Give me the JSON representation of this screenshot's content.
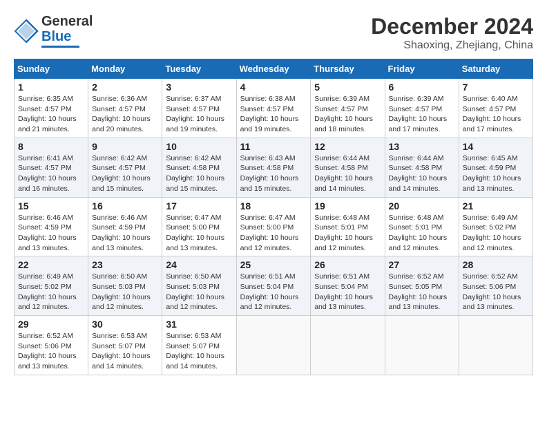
{
  "header": {
    "logo_line1": "General",
    "logo_line2": "Blue",
    "month": "December 2024",
    "location": "Shaoxing, Zhejiang, China"
  },
  "weekdays": [
    "Sunday",
    "Monday",
    "Tuesday",
    "Wednesday",
    "Thursday",
    "Friday",
    "Saturday"
  ],
  "weeks": [
    [
      {
        "day": "1",
        "sunrise": "Sunrise: 6:35 AM",
        "sunset": "Sunset: 4:57 PM",
        "daylight": "Daylight: 10 hours and 21 minutes."
      },
      {
        "day": "2",
        "sunrise": "Sunrise: 6:36 AM",
        "sunset": "Sunset: 4:57 PM",
        "daylight": "Daylight: 10 hours and 20 minutes."
      },
      {
        "day": "3",
        "sunrise": "Sunrise: 6:37 AM",
        "sunset": "Sunset: 4:57 PM",
        "daylight": "Daylight: 10 hours and 19 minutes."
      },
      {
        "day": "4",
        "sunrise": "Sunrise: 6:38 AM",
        "sunset": "Sunset: 4:57 PM",
        "daylight": "Daylight: 10 hours and 19 minutes."
      },
      {
        "day": "5",
        "sunrise": "Sunrise: 6:39 AM",
        "sunset": "Sunset: 4:57 PM",
        "daylight": "Daylight: 10 hours and 18 minutes."
      },
      {
        "day": "6",
        "sunrise": "Sunrise: 6:39 AM",
        "sunset": "Sunset: 4:57 PM",
        "daylight": "Daylight: 10 hours and 17 minutes."
      },
      {
        "day": "7",
        "sunrise": "Sunrise: 6:40 AM",
        "sunset": "Sunset: 4:57 PM",
        "daylight": "Daylight: 10 hours and 17 minutes."
      }
    ],
    [
      {
        "day": "8",
        "sunrise": "Sunrise: 6:41 AM",
        "sunset": "Sunset: 4:57 PM",
        "daylight": "Daylight: 10 hours and 16 minutes."
      },
      {
        "day": "9",
        "sunrise": "Sunrise: 6:42 AM",
        "sunset": "Sunset: 4:57 PM",
        "daylight": "Daylight: 10 hours and 15 minutes."
      },
      {
        "day": "10",
        "sunrise": "Sunrise: 6:42 AM",
        "sunset": "Sunset: 4:58 PM",
        "daylight": "Daylight: 10 hours and 15 minutes."
      },
      {
        "day": "11",
        "sunrise": "Sunrise: 6:43 AM",
        "sunset": "Sunset: 4:58 PM",
        "daylight": "Daylight: 10 hours and 15 minutes."
      },
      {
        "day": "12",
        "sunrise": "Sunrise: 6:44 AM",
        "sunset": "Sunset: 4:58 PM",
        "daylight": "Daylight: 10 hours and 14 minutes."
      },
      {
        "day": "13",
        "sunrise": "Sunrise: 6:44 AM",
        "sunset": "Sunset: 4:58 PM",
        "daylight": "Daylight: 10 hours and 14 minutes."
      },
      {
        "day": "14",
        "sunrise": "Sunrise: 6:45 AM",
        "sunset": "Sunset: 4:59 PM",
        "daylight": "Daylight: 10 hours and 13 minutes."
      }
    ],
    [
      {
        "day": "15",
        "sunrise": "Sunrise: 6:46 AM",
        "sunset": "Sunset: 4:59 PM",
        "daylight": "Daylight: 10 hours and 13 minutes."
      },
      {
        "day": "16",
        "sunrise": "Sunrise: 6:46 AM",
        "sunset": "Sunset: 4:59 PM",
        "daylight": "Daylight: 10 hours and 13 minutes."
      },
      {
        "day": "17",
        "sunrise": "Sunrise: 6:47 AM",
        "sunset": "Sunset: 5:00 PM",
        "daylight": "Daylight: 10 hours and 13 minutes."
      },
      {
        "day": "18",
        "sunrise": "Sunrise: 6:47 AM",
        "sunset": "Sunset: 5:00 PM",
        "daylight": "Daylight: 10 hours and 12 minutes."
      },
      {
        "day": "19",
        "sunrise": "Sunrise: 6:48 AM",
        "sunset": "Sunset: 5:01 PM",
        "daylight": "Daylight: 10 hours and 12 minutes."
      },
      {
        "day": "20",
        "sunrise": "Sunrise: 6:48 AM",
        "sunset": "Sunset: 5:01 PM",
        "daylight": "Daylight: 10 hours and 12 minutes."
      },
      {
        "day": "21",
        "sunrise": "Sunrise: 6:49 AM",
        "sunset": "Sunset: 5:02 PM",
        "daylight": "Daylight: 10 hours and 12 minutes."
      }
    ],
    [
      {
        "day": "22",
        "sunrise": "Sunrise: 6:49 AM",
        "sunset": "Sunset: 5:02 PM",
        "daylight": "Daylight: 10 hours and 12 minutes."
      },
      {
        "day": "23",
        "sunrise": "Sunrise: 6:50 AM",
        "sunset": "Sunset: 5:03 PM",
        "daylight": "Daylight: 10 hours and 12 minutes."
      },
      {
        "day": "24",
        "sunrise": "Sunrise: 6:50 AM",
        "sunset": "Sunset: 5:03 PM",
        "daylight": "Daylight: 10 hours and 12 minutes."
      },
      {
        "day": "25",
        "sunrise": "Sunrise: 6:51 AM",
        "sunset": "Sunset: 5:04 PM",
        "daylight": "Daylight: 10 hours and 12 minutes."
      },
      {
        "day": "26",
        "sunrise": "Sunrise: 6:51 AM",
        "sunset": "Sunset: 5:04 PM",
        "daylight": "Daylight: 10 hours and 13 minutes."
      },
      {
        "day": "27",
        "sunrise": "Sunrise: 6:52 AM",
        "sunset": "Sunset: 5:05 PM",
        "daylight": "Daylight: 10 hours and 13 minutes."
      },
      {
        "day": "28",
        "sunrise": "Sunrise: 6:52 AM",
        "sunset": "Sunset: 5:06 PM",
        "daylight": "Daylight: 10 hours and 13 minutes."
      }
    ],
    [
      {
        "day": "29",
        "sunrise": "Sunrise: 6:52 AM",
        "sunset": "Sunset: 5:06 PM",
        "daylight": "Daylight: 10 hours and 13 minutes."
      },
      {
        "day": "30",
        "sunrise": "Sunrise: 6:53 AM",
        "sunset": "Sunset: 5:07 PM",
        "daylight": "Daylight: 10 hours and 14 minutes."
      },
      {
        "day": "31",
        "sunrise": "Sunrise: 6:53 AM",
        "sunset": "Sunset: 5:07 PM",
        "daylight": "Daylight: 10 hours and 14 minutes."
      },
      null,
      null,
      null,
      null
    ]
  ]
}
